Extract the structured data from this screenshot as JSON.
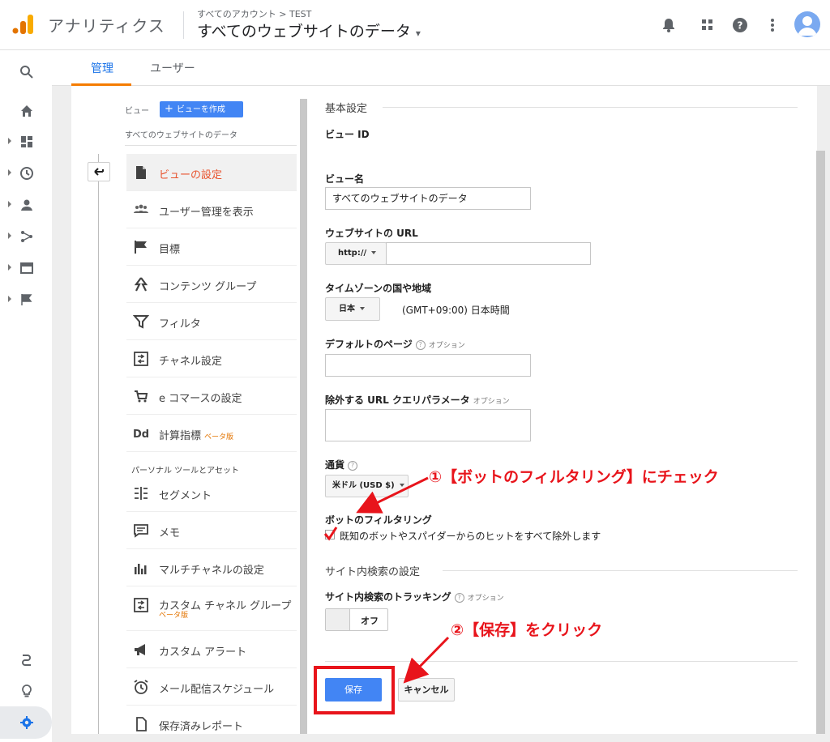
{
  "app": {
    "name": "アナリティクス",
    "breadcrumb": "すべてのアカウント > TEST",
    "property": "すべてのウェブサイトのデータ",
    "property_caret": "▾"
  },
  "tabs": [
    {
      "label": "管理"
    },
    {
      "label": "ユーザー"
    }
  ],
  "view": {
    "label": "ビュー",
    "create_button": "ビューを作成",
    "name": "すべてのウェブサイトのデータ"
  },
  "menu": [
    {
      "label": "ビューの設定",
      "icon": "document-icon"
    },
    {
      "label": "ユーザー管理を表示",
      "icon": "people-icon"
    },
    {
      "label": "目標",
      "icon": "flag-icon"
    },
    {
      "label": "コンテンツ グループ",
      "icon": "content-group-icon"
    },
    {
      "label": "フィルタ",
      "icon": "filter-icon"
    },
    {
      "label": "チャネル設定",
      "icon": "channel-icon"
    },
    {
      "label": "e コマースの設定",
      "icon": "cart-icon"
    },
    {
      "label": "計算指標",
      "icon": "dd-icon",
      "badge": "ベータ版"
    }
  ],
  "personal_section": "パーソナル ツールとアセット",
  "menu2": [
    {
      "label": "セグメント",
      "icon": "segment-icon"
    },
    {
      "label": "メモ",
      "icon": "memo-icon"
    },
    {
      "label": "マルチチャネルの設定",
      "icon": "multichannel-icon"
    },
    {
      "label": "カスタム チャネル グループ",
      "icon": "custom-channel-icon",
      "badge": "ベータ版"
    },
    {
      "label": "カスタム アラート",
      "icon": "megaphone-icon"
    },
    {
      "label": "メール配信スケジュール",
      "icon": "alarm-clock-icon"
    },
    {
      "label": "保存済みレポート",
      "icon": "saved-report-icon"
    }
  ],
  "settings": {
    "basic_title": "基本設定",
    "view_id_label": "ビュー ID",
    "view_name_label": "ビュー名",
    "view_name_value": "すべてのウェブサイトのデータ",
    "url_label": "ウェブサイトの URL",
    "url_protocol": "http://",
    "tz_label": "タイムゾーンの国や地域",
    "tz_country": "日本",
    "tz_value": "(GMT+09:00) 日本時間",
    "default_page_label": "デフォルトのページ",
    "optional": "オプション",
    "exclude_label": "除外する URL クエリパラメータ",
    "currency_label": "通貨",
    "currency_value": "米ドル (USD $)",
    "bot_label": "ボットのフィルタリング",
    "bot_checkbox": "既知のボットやスパイダーからのヒットをすべて除外します",
    "bot_checked": true,
    "site_search_title": "サイト内検索の設定",
    "site_search_label": "サイト内検索のトラッキング",
    "toggle_value": "オフ",
    "save": "保存",
    "cancel": "キャンセル",
    "help_mark": "?"
  },
  "annotations": {
    "step1": "①【ボットのフィルタリング】にチェック",
    "step2": "②【保存】をクリック"
  },
  "colors": {
    "accent": "#4285f4",
    "active_text": "#e8542f",
    "tab_underline": "#f57c00",
    "annotation": "#e8141b"
  }
}
